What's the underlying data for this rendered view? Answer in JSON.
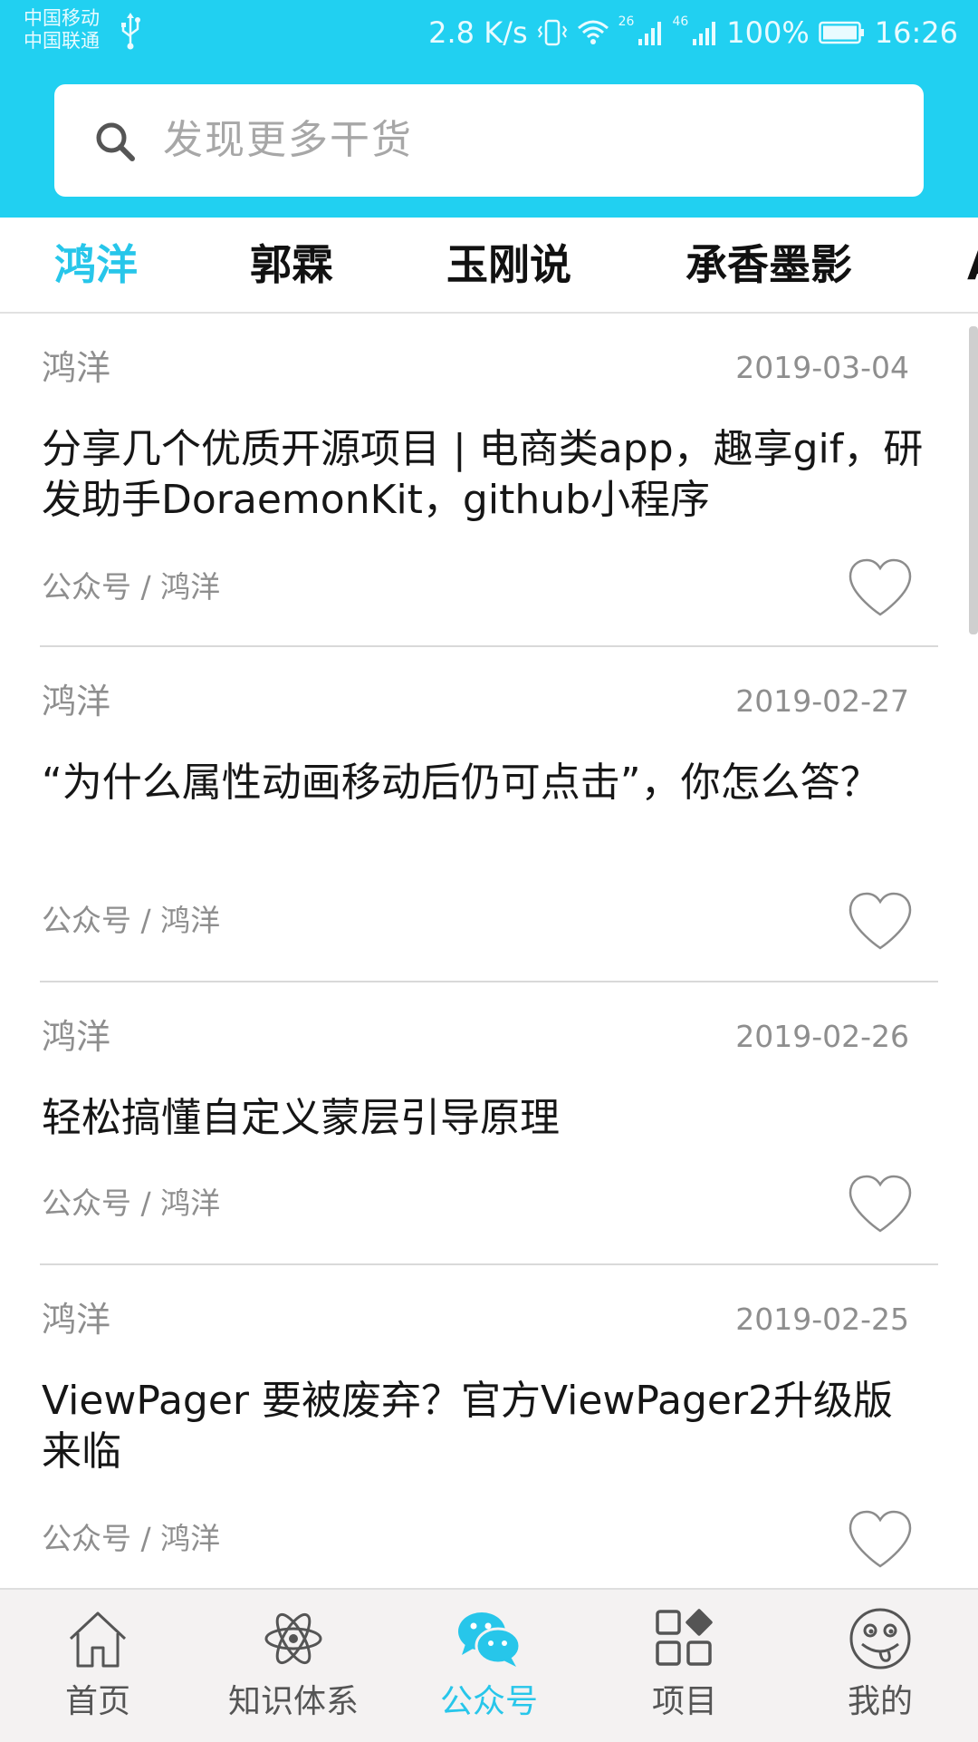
{
  "status_bar": {
    "carrier_1": "中国移动",
    "carrier_2": "中国联通",
    "net_speed": "2.8 K/s",
    "network_1": "26",
    "network_2": "46",
    "battery": "100%",
    "time": "16:26"
  },
  "search": {
    "placeholder": "发现更多干货"
  },
  "tabs": [
    {
      "label": "鸿洋",
      "active": true
    },
    {
      "label": "郭霖",
      "active": false
    },
    {
      "label": "玉刚说",
      "active": false
    },
    {
      "label": "承香墨影",
      "active": false
    },
    {
      "label": "A",
      "active": false
    }
  ],
  "articles": [
    {
      "author": "鸿洋",
      "date": "2019-03-04",
      "title": "分享几个优质开源项目 | 电商类app，趣享gif，研发助手DoraemonKit，github小程序",
      "source": "公众号 / 鸿洋"
    },
    {
      "author": "鸿洋",
      "date": "2019-02-27",
      "title": "“为什么属性动画移动后仍可点击”，你怎么答？",
      "source": "公众号 / 鸿洋"
    },
    {
      "author": "鸿洋",
      "date": "2019-02-26",
      "title": "轻松搞懂自定义蒙层引导原理",
      "source": "公众号 / 鸿洋"
    },
    {
      "author": "鸿洋",
      "date": "2019-02-25",
      "title": "ViewPager 要被废弃？官方ViewPager2升级版来临",
      "source": "公众号 / 鸿洋"
    }
  ],
  "bottom_nav": [
    {
      "label": "首页",
      "icon": "home-icon",
      "active": false
    },
    {
      "label": "知识体系",
      "icon": "atom-icon",
      "active": false
    },
    {
      "label": "公众号",
      "icon": "wechat-icon",
      "active": true
    },
    {
      "label": "项目",
      "icon": "grid-icon",
      "active": false
    },
    {
      "label": "我的",
      "icon": "smiley-icon",
      "active": false
    }
  ],
  "colors": {
    "header": "#21d0f1",
    "accent": "#27c6ea",
    "nav_inactive": "#555555",
    "meta_gray": "#8e8e8e"
  }
}
